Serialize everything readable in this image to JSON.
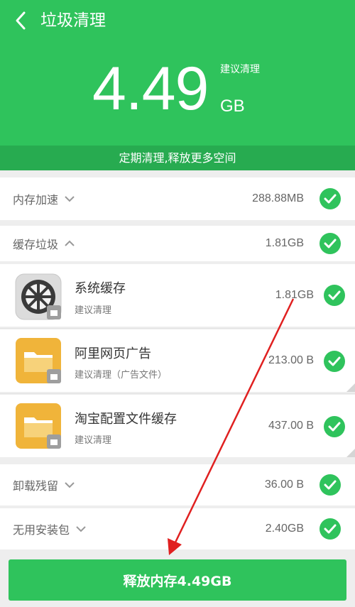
{
  "header": {
    "title": "垃圾清理",
    "amount": "4.49",
    "unit": "GB",
    "suggest": "建议清理",
    "banner": "定期清理,释放更多空间"
  },
  "categories": [
    {
      "label": "内存加速",
      "size": "288.88MB"
    },
    {
      "label": "缓存垃圾",
      "size": "1.81GB"
    },
    {
      "label": "卸载残留",
      "size": "36.00 B"
    },
    {
      "label": "无用安装包",
      "size": "2.40GB"
    }
  ],
  "cache_items": [
    {
      "name": "系统缓存",
      "sub": "建议清理",
      "size": "1.81GB",
      "icon": "gear-icon"
    },
    {
      "name": "阿里网页广告",
      "sub": "建议清理（广告文件）",
      "size": "213.00 B",
      "icon": "folder-icon"
    },
    {
      "name": "淘宝配置文件缓存",
      "sub": "建议清理",
      "size": "437.00 B",
      "icon": "folder-icon"
    }
  ],
  "footer": {
    "release_label": "释放内存4.49GB"
  },
  "colors": {
    "brand": "#2fc35c",
    "banner": "#27ab50",
    "folder": "#f0b43a",
    "arrow": "#e02020"
  }
}
